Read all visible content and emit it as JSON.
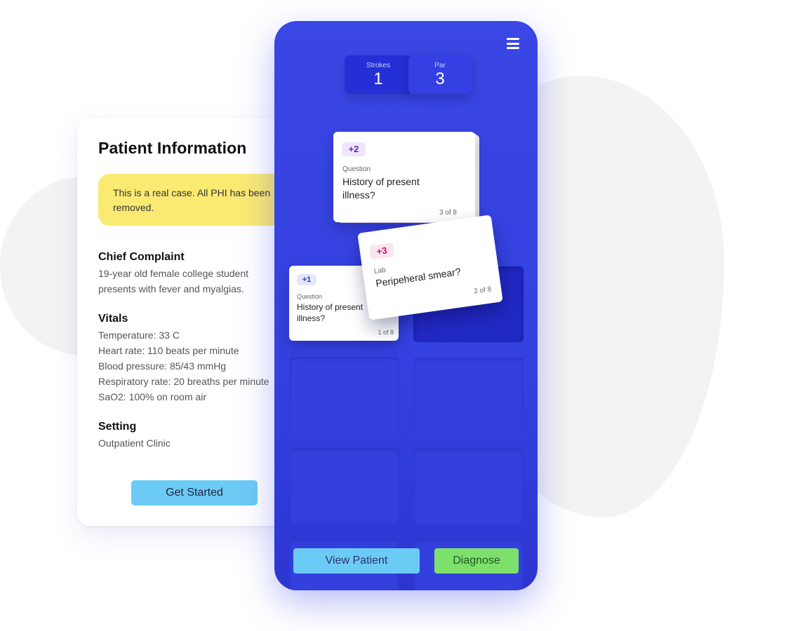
{
  "patient_info": {
    "title": "Patient Information",
    "notice": "This is a real case. All PHI has been removed.",
    "chief_complaint": {
      "heading": "Chief Complaint",
      "text_line1": "19-year old female college student",
      "text_line2": "presents with fever and myalgias."
    },
    "vitals": {
      "heading": "Vitals",
      "items": [
        "Temperature: 33 C",
        "Heart rate: 110 beats per minute",
        "Blood pressure: 85/43 mmHg",
        "Respiratory rate: 20 breaths per minute",
        "SaO2: 100% on room air"
      ]
    },
    "setting": {
      "heading": "Setting",
      "text": "Outpatient Clinic"
    },
    "get_started_label": "Get Started"
  },
  "game": {
    "strokes": {
      "label": "Strokes",
      "value": "1"
    },
    "par": {
      "label": "Par",
      "value": "3"
    },
    "cards": [
      {
        "badge": "+2",
        "type": "Question",
        "text_line1": "History of present",
        "text_line2": "illness?",
        "count": "3 of 8"
      },
      {
        "badge": "+3",
        "type": "Lab",
        "text_line1": "Peripeheral smear?",
        "count": "2 of 8"
      },
      {
        "badge": "+1",
        "type": "Question",
        "text_line1": "History of present",
        "text_line2": "illness?",
        "count": "1 of 8"
      }
    ],
    "view_patient_label": "View Patient",
    "diagnose_label": "Diagnose"
  },
  "colors": {
    "phone_blue": "#3a47e4",
    "notice_yellow": "#fbea72",
    "button_blue": "#6ccbf5",
    "button_green": "#7ee06c",
    "badge_purple": "#6b1fd6",
    "badge_magenta": "#c8106e",
    "badge_indigo": "#2a36c8"
  }
}
